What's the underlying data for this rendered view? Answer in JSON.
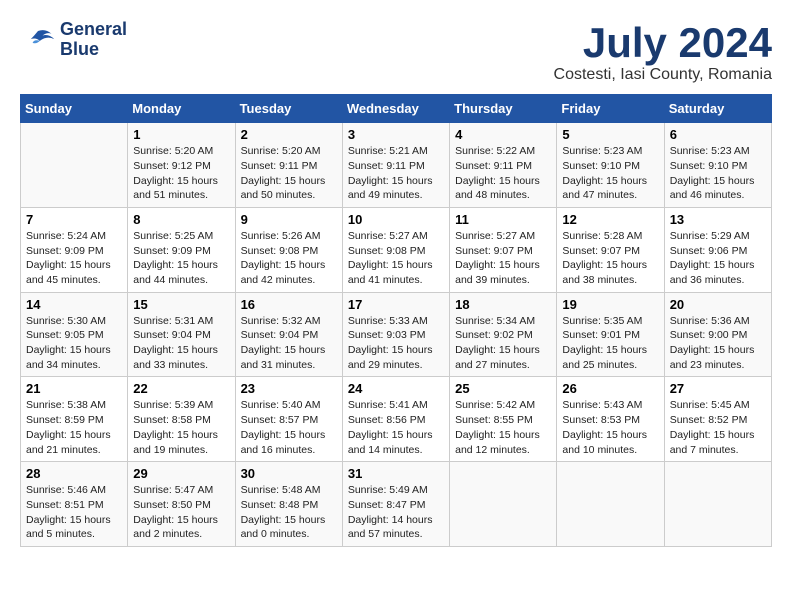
{
  "logo": {
    "line1": "General",
    "line2": "Blue"
  },
  "title": "July 2024",
  "subtitle": "Costesti, Iasi County, Romania",
  "weekdays": [
    "Sunday",
    "Monday",
    "Tuesday",
    "Wednesday",
    "Thursday",
    "Friday",
    "Saturday"
  ],
  "weeks": [
    [
      {
        "day": "",
        "info": ""
      },
      {
        "day": "1",
        "info": "Sunrise: 5:20 AM\nSunset: 9:12 PM\nDaylight: 15 hours\nand 51 minutes."
      },
      {
        "day": "2",
        "info": "Sunrise: 5:20 AM\nSunset: 9:11 PM\nDaylight: 15 hours\nand 50 minutes."
      },
      {
        "day": "3",
        "info": "Sunrise: 5:21 AM\nSunset: 9:11 PM\nDaylight: 15 hours\nand 49 minutes."
      },
      {
        "day": "4",
        "info": "Sunrise: 5:22 AM\nSunset: 9:11 PM\nDaylight: 15 hours\nand 48 minutes."
      },
      {
        "day": "5",
        "info": "Sunrise: 5:23 AM\nSunset: 9:10 PM\nDaylight: 15 hours\nand 47 minutes."
      },
      {
        "day": "6",
        "info": "Sunrise: 5:23 AM\nSunset: 9:10 PM\nDaylight: 15 hours\nand 46 minutes."
      }
    ],
    [
      {
        "day": "7",
        "info": "Sunrise: 5:24 AM\nSunset: 9:09 PM\nDaylight: 15 hours\nand 45 minutes."
      },
      {
        "day": "8",
        "info": "Sunrise: 5:25 AM\nSunset: 9:09 PM\nDaylight: 15 hours\nand 44 minutes."
      },
      {
        "day": "9",
        "info": "Sunrise: 5:26 AM\nSunset: 9:08 PM\nDaylight: 15 hours\nand 42 minutes."
      },
      {
        "day": "10",
        "info": "Sunrise: 5:27 AM\nSunset: 9:08 PM\nDaylight: 15 hours\nand 41 minutes."
      },
      {
        "day": "11",
        "info": "Sunrise: 5:27 AM\nSunset: 9:07 PM\nDaylight: 15 hours\nand 39 minutes."
      },
      {
        "day": "12",
        "info": "Sunrise: 5:28 AM\nSunset: 9:07 PM\nDaylight: 15 hours\nand 38 minutes."
      },
      {
        "day": "13",
        "info": "Sunrise: 5:29 AM\nSunset: 9:06 PM\nDaylight: 15 hours\nand 36 minutes."
      }
    ],
    [
      {
        "day": "14",
        "info": "Sunrise: 5:30 AM\nSunset: 9:05 PM\nDaylight: 15 hours\nand 34 minutes."
      },
      {
        "day": "15",
        "info": "Sunrise: 5:31 AM\nSunset: 9:04 PM\nDaylight: 15 hours\nand 33 minutes."
      },
      {
        "day": "16",
        "info": "Sunrise: 5:32 AM\nSunset: 9:04 PM\nDaylight: 15 hours\nand 31 minutes."
      },
      {
        "day": "17",
        "info": "Sunrise: 5:33 AM\nSunset: 9:03 PM\nDaylight: 15 hours\nand 29 minutes."
      },
      {
        "day": "18",
        "info": "Sunrise: 5:34 AM\nSunset: 9:02 PM\nDaylight: 15 hours\nand 27 minutes."
      },
      {
        "day": "19",
        "info": "Sunrise: 5:35 AM\nSunset: 9:01 PM\nDaylight: 15 hours\nand 25 minutes."
      },
      {
        "day": "20",
        "info": "Sunrise: 5:36 AM\nSunset: 9:00 PM\nDaylight: 15 hours\nand 23 minutes."
      }
    ],
    [
      {
        "day": "21",
        "info": "Sunrise: 5:38 AM\nSunset: 8:59 PM\nDaylight: 15 hours\nand 21 minutes."
      },
      {
        "day": "22",
        "info": "Sunrise: 5:39 AM\nSunset: 8:58 PM\nDaylight: 15 hours\nand 19 minutes."
      },
      {
        "day": "23",
        "info": "Sunrise: 5:40 AM\nSunset: 8:57 PM\nDaylight: 15 hours\nand 16 minutes."
      },
      {
        "day": "24",
        "info": "Sunrise: 5:41 AM\nSunset: 8:56 PM\nDaylight: 15 hours\nand 14 minutes."
      },
      {
        "day": "25",
        "info": "Sunrise: 5:42 AM\nSunset: 8:55 PM\nDaylight: 15 hours\nand 12 minutes."
      },
      {
        "day": "26",
        "info": "Sunrise: 5:43 AM\nSunset: 8:53 PM\nDaylight: 15 hours\nand 10 minutes."
      },
      {
        "day": "27",
        "info": "Sunrise: 5:45 AM\nSunset: 8:52 PM\nDaylight: 15 hours\nand 7 minutes."
      }
    ],
    [
      {
        "day": "28",
        "info": "Sunrise: 5:46 AM\nSunset: 8:51 PM\nDaylight: 15 hours\nand 5 minutes."
      },
      {
        "day": "29",
        "info": "Sunrise: 5:47 AM\nSunset: 8:50 PM\nDaylight: 15 hours\nand 2 minutes."
      },
      {
        "day": "30",
        "info": "Sunrise: 5:48 AM\nSunset: 8:48 PM\nDaylight: 15 hours\nand 0 minutes."
      },
      {
        "day": "31",
        "info": "Sunrise: 5:49 AM\nSunset: 8:47 PM\nDaylight: 14 hours\nand 57 minutes."
      },
      {
        "day": "",
        "info": ""
      },
      {
        "day": "",
        "info": ""
      },
      {
        "day": "",
        "info": ""
      }
    ]
  ]
}
